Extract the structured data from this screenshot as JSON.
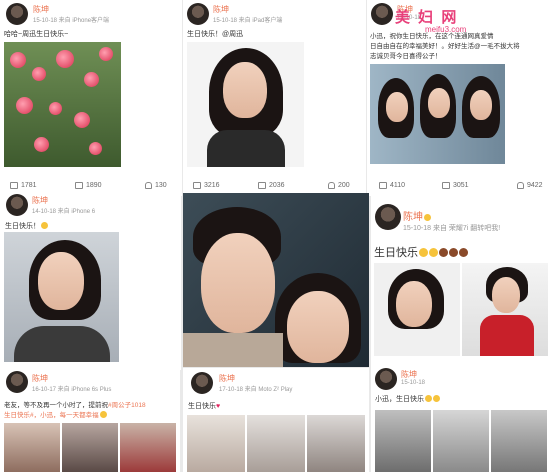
{
  "posts": [
    {
      "name": "陈坤",
      "meta": "15-10-18  来自 iPhone客户端",
      "text": "哈哈~周迅生日快乐~",
      "shares": "1781",
      "comments": "1890",
      "likes": "130"
    },
    {
      "name": "陈坤",
      "meta": "15-10-18  来自 iPad客户端",
      "text": "生日快乐！@周迅",
      "shares": "3216",
      "comments": "2036",
      "likes": "200"
    },
    {
      "name": "陈坤",
      "meta": "15-10-18",
      "text1": "小迅，祝你生日快乐，在这个连通网真爱情",
      "text2": "日自由自在的幸福美好！。好好生活@一毛不拔大将",
      "text3": "志诚贝哥今日喜得公子！",
      "shares": "4110",
      "comments": "3051",
      "likes": "9422"
    },
    {
      "name": "陈坤",
      "meta": "14-10-18  来自 iPhone 6",
      "text": "生日快乐！"
    },
    {
      "name": "陈坤",
      "meta": "16-10-17  来自 iPhone 6s Plus",
      "text1": "老友，等不及再一个小时了，提前祝",
      "tag": "#周公子1018",
      "text2": "生日快乐#，小迅，每一天都幸福"
    },
    {
      "name": "陈坤",
      "meta": "17-10-18  来自 Moto Z² Play",
      "text": "生日快乐"
    },
    {
      "name": "陈坤",
      "meta": "15-10-18  来自 荣耀7i 翻转吧我!",
      "text": "生日快乐"
    },
    {
      "name": "陈坤",
      "meta": "15-10-18",
      "text": "小迅，生日快乐"
    }
  ],
  "watermark": {
    "logo": "美 妇 网",
    "url": "meifu3.com"
  }
}
